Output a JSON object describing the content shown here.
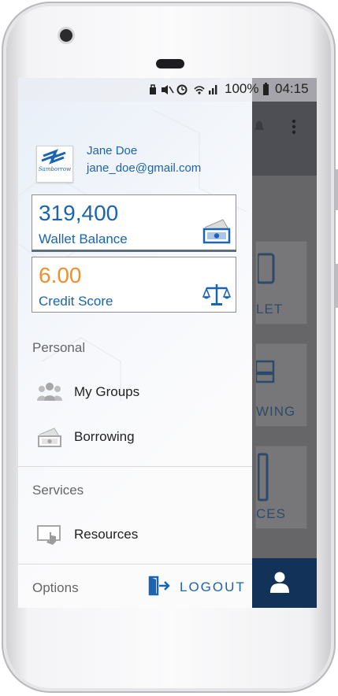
{
  "statusbar": {
    "battery": "100%",
    "time": "04:15"
  },
  "profile": {
    "name": "Jane Doe",
    "email": "jane_doe@gmail.com",
    "avatar_logo_text": "Samborrow"
  },
  "wallet": {
    "value": "319,400",
    "caption": "Wallet Balance",
    "value_color": "#1a64b0"
  },
  "credit": {
    "value": "6.00",
    "caption": "Credit Score",
    "value_color": "#f0902a"
  },
  "sections": {
    "personal": "Personal",
    "services": "Services",
    "options": "Options"
  },
  "menu": {
    "my_groups": "My Groups",
    "borrowing": "Borrowing",
    "resources": "Resources"
  },
  "logout_label": "LOGOUT",
  "background_app": {
    "labels": [
      "LET",
      "WING",
      "CES"
    ]
  },
  "colors": {
    "brand_blue": "#1a64b0",
    "accent_orange": "#f0902a",
    "navy": "#13325a"
  }
}
